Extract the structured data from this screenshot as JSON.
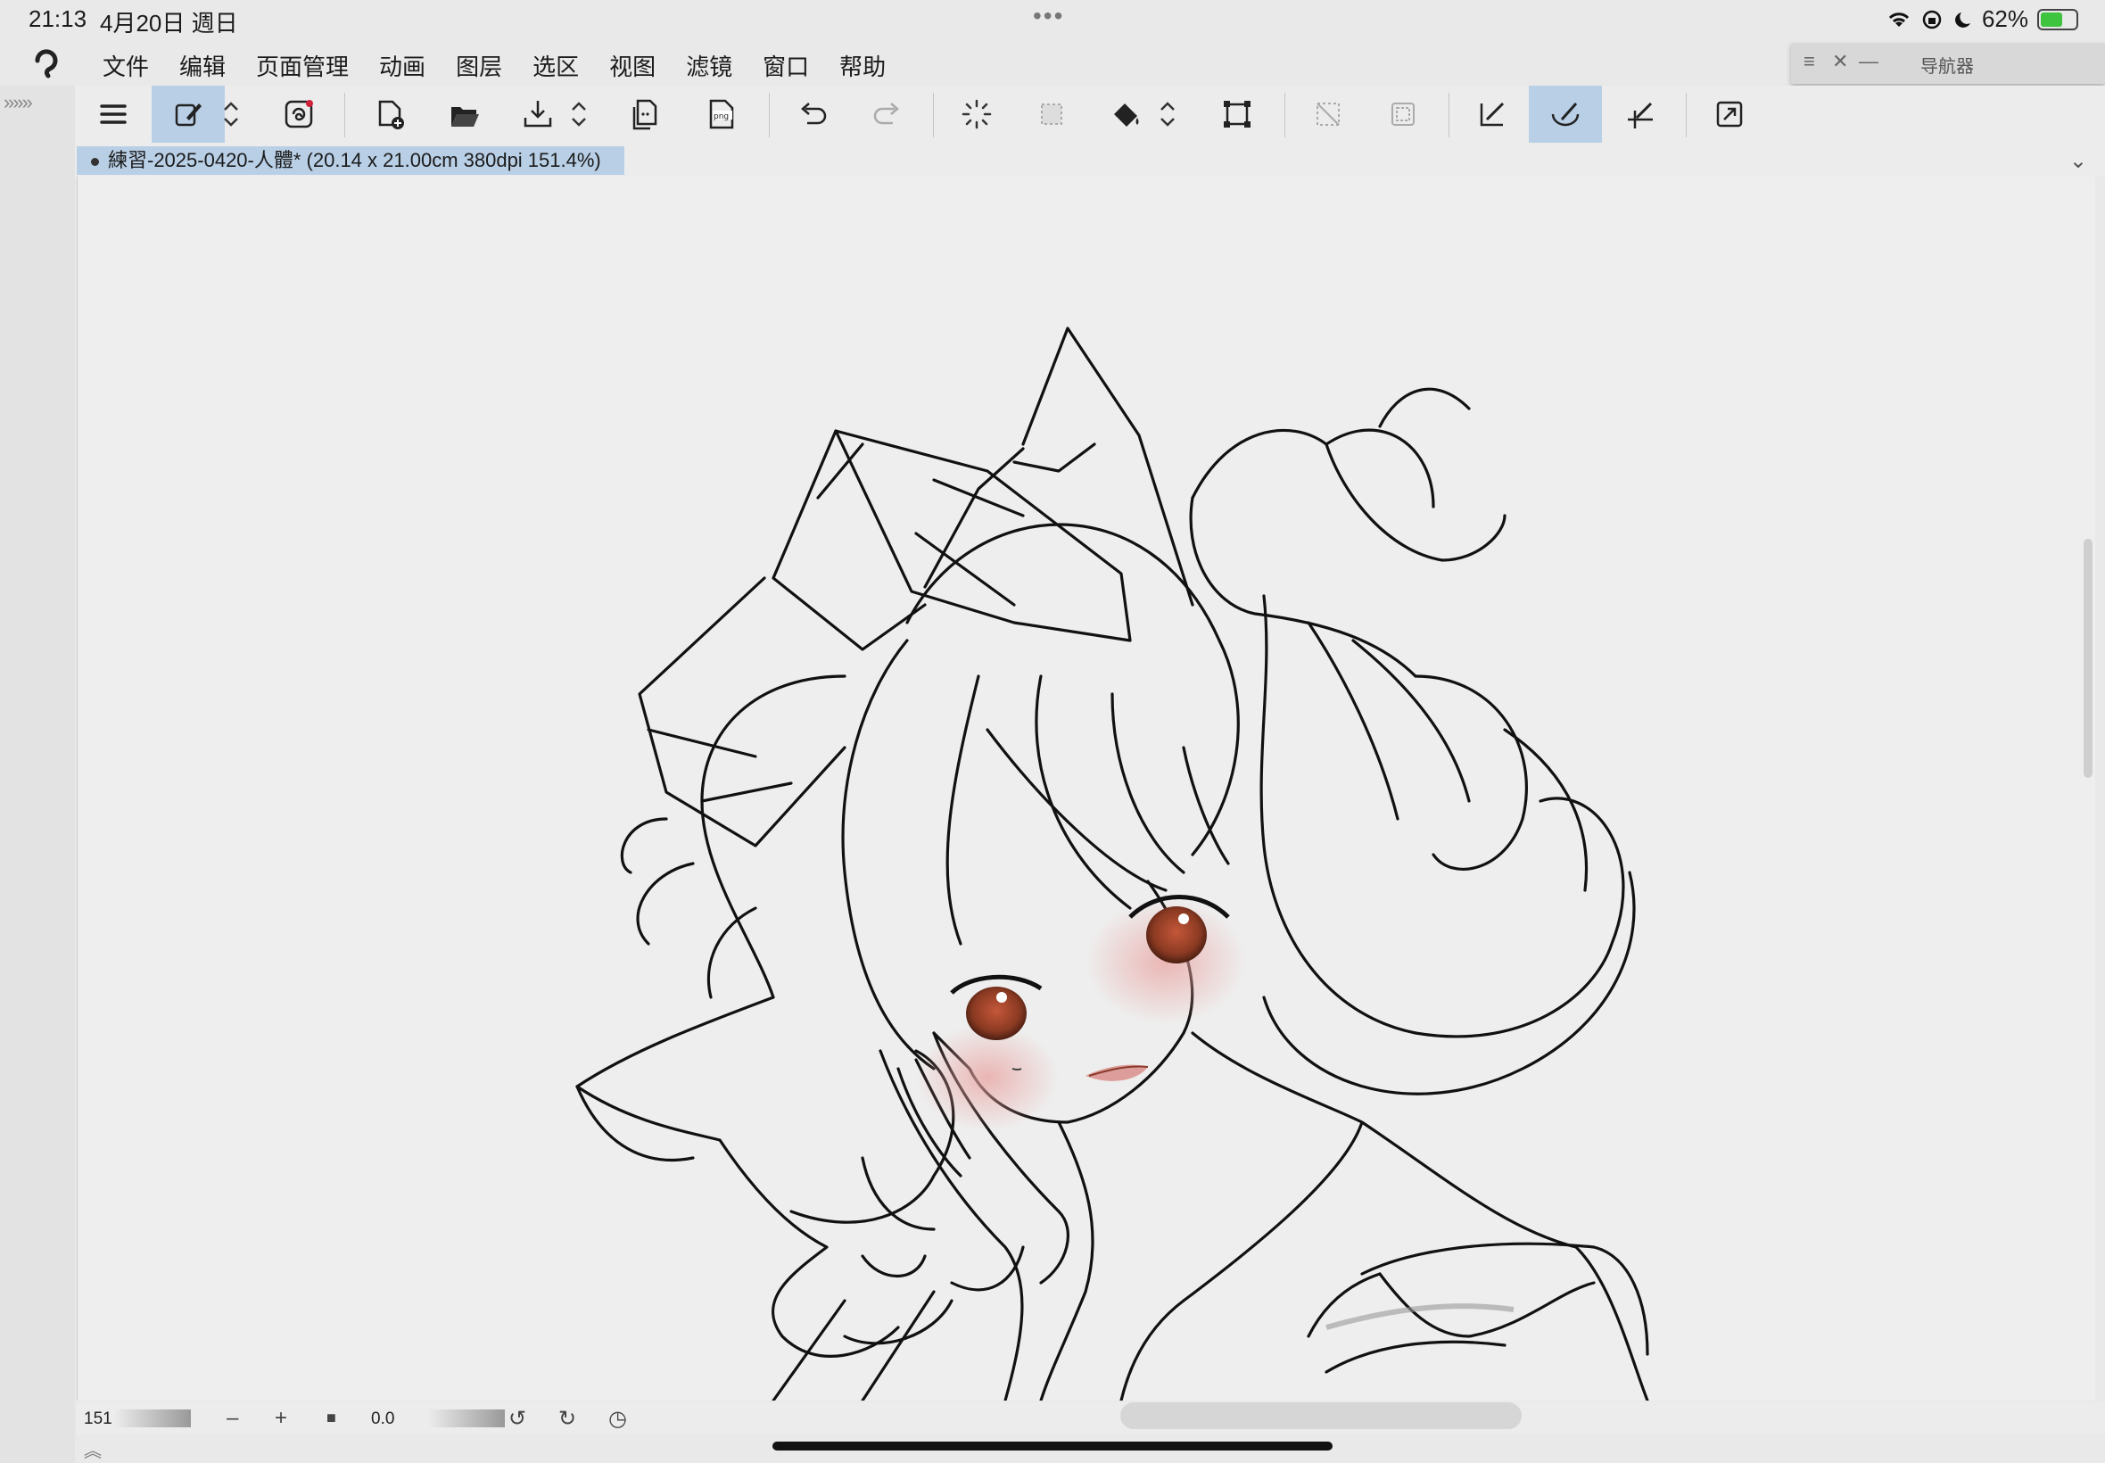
{
  "status": {
    "time": "21:13",
    "date": "4月20日 週日",
    "battery": "62%",
    "battery_level": 0.62,
    "dots": "•••"
  },
  "menu": {
    "items": [
      "文件",
      "编辑",
      "页面管理",
      "动画",
      "图层",
      "选区",
      "视图",
      "滤镜",
      "窗口",
      "帮助"
    ]
  },
  "navigator": {
    "title": "导航器"
  },
  "document_tab": {
    "label": "練習-2025-0420-人體* (20.14 x 21.00cm 380dpi 151.4%)"
  },
  "bottom": {
    "zoom": "151.4",
    "rotation": "0.0",
    "zoom_out": "–",
    "zoom_in": "+"
  },
  "colors": {
    "active_tool_bg": "#b9cfe6",
    "canvas_bg": "#eeeeee",
    "eye_color": "#8b3a22",
    "blush_color": "#e8a3a0"
  },
  "left_strip_arrows": "»»»"
}
